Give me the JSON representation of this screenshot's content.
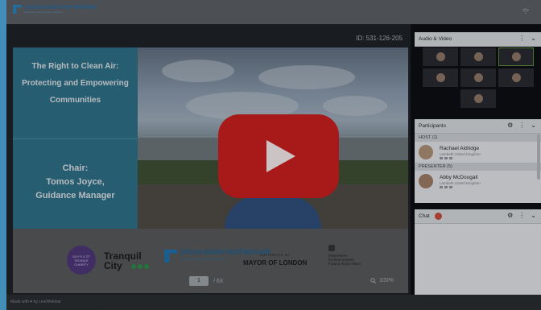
{
  "brand": {
    "name": "CROSS RIVER PARTNERSHIP",
    "tagline": "Delivering London's Future Together"
  },
  "meeting": {
    "id_label": "ID: 531-126-205"
  },
  "slide": {
    "title_lines": [
      "The Right to Clean Air:",
      "Protecting and Empowering",
      "Communities"
    ],
    "chair_lines": [
      "Chair:",
      "Tomos Joyce,",
      "Guidance Manager"
    ],
    "sponsors": {
      "guys": "GUY'S & ST THOMAS' CHARITY",
      "tranquil": [
        "Tranquil",
        "City"
      ],
      "crp_name": "CROSS RIVER PARTNERSHIP",
      "crp_tag": "Delivering London's Future Together",
      "mayor_small": "SUPPORTED BY",
      "mayor_big": "MAYOR OF LONDON",
      "defra": [
        "Department",
        "for Environment",
        "Food & Rural Affairs"
      ]
    }
  },
  "pager": {
    "current": "1",
    "total": "/ 63",
    "zoom": "100%"
  },
  "sidebar": {
    "audio_video": {
      "title": "Audio & Video"
    },
    "participants": {
      "title": "Participants",
      "host_label": "HOST (1)",
      "presenter_label": "PRESENTER (5)",
      "host": {
        "name": "Rachael Aldridge",
        "location": "Lambeth United Kingdom"
      },
      "presenter": {
        "name": "Abby McDougall",
        "location": "Lambeth United Kingdom"
      }
    },
    "chat": {
      "title": "Chat"
    }
  },
  "footer": {
    "text": "Made with ♥ by LiveWebinar"
  },
  "colors": {
    "accent": "#4da8d6",
    "play": "#c61e1e",
    "slide_panel": "#2d6e85"
  },
  "icons": [
    "wifi-icon",
    "play-icon",
    "zoom-icon",
    "more-icon",
    "chevron-down-icon",
    "gear-icon"
  ]
}
